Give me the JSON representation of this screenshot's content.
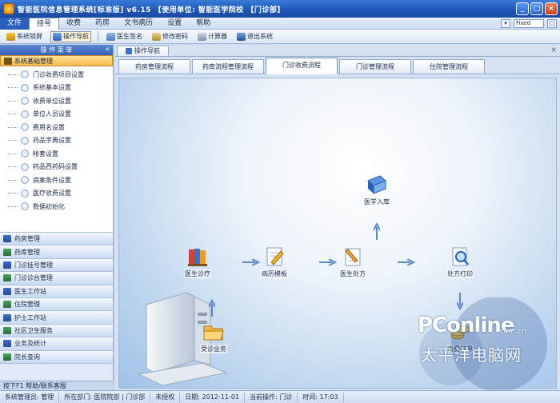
{
  "window": {
    "title": "智能医院信息管理系统[标准版] v6.15 【使用单位: 智能医学院校 【门诊部】",
    "minimize": "_",
    "maximize": "□",
    "close": "×"
  },
  "menu": {
    "items": [
      "文件",
      "挂号",
      "收费",
      "药房",
      "文书病历",
      "设置",
      "帮助"
    ],
    "font_select": "Fixed",
    "right_btn": "□"
  },
  "toolbar": {
    "buttons": [
      "系统锁屏",
      "操作导航",
      "医生签名",
      "修改密码",
      "计算器",
      "退出系统"
    ]
  },
  "left_panel": {
    "header": "操 作 菜 单",
    "collapse": "«",
    "active_group": "系统基础管理",
    "sub_items": [
      "门诊收费项目设置",
      "系统基本设置",
      "收费单位设置",
      "单位人员设置",
      "费用名设置",
      "药品字典设置",
      "帐套设置",
      "药品西药码设置",
      "病案条件设置",
      "医疗收费设置",
      "数据初始化"
    ],
    "groups": [
      "药房管理",
      "药库管理",
      "门诊挂号管理",
      "门诊诊台管理",
      "医生工作站",
      "住院管理",
      "护士工作站",
      "社区卫生服务",
      "业务及统计",
      "院长查询"
    ],
    "footer": "按下F1 帮助/联系客服"
  },
  "main": {
    "outer_tab": "操作导航",
    "outer_close": "×",
    "inner_tabs": [
      "药房管理流程",
      "药库流程管理流程",
      "门诊收费流程",
      "门诊管理流程",
      "住院管理流程"
    ],
    "active_inner_tab": 2,
    "nodes": {
      "n1": "医生诊疗",
      "n2": "病历模板",
      "n3": "医生处方",
      "n4": "处方打印",
      "n5": "医学入库",
      "n6": "受诊业务",
      "n7": "收费打单"
    }
  },
  "watermark": {
    "brand": "PConline",
    "domain": ".com.cn",
    "cn": "太平洋电脑网"
  },
  "status": {
    "items": [
      "系统管理员: 管理",
      "所在部门: 医院院部 | 门诊部",
      "未授权",
      "日期: 2012-11-01",
      "当前操作: 门诊",
      "时间: 17:03"
    ]
  },
  "colors": {
    "accent": "#2a5fba",
    "active_group": "#f5b947"
  }
}
